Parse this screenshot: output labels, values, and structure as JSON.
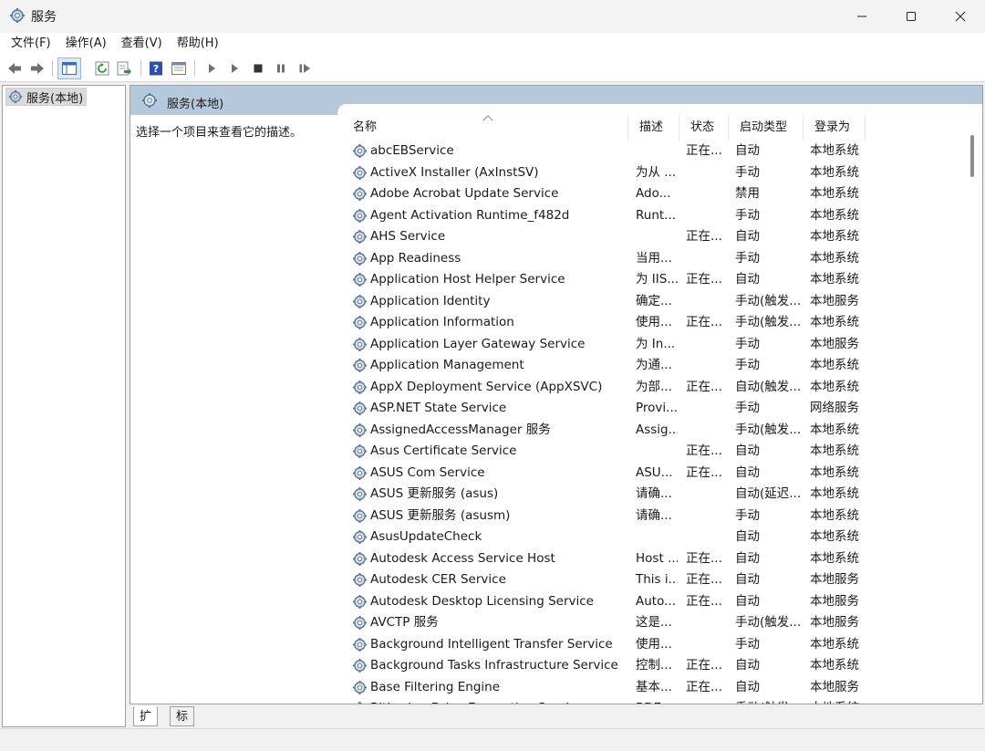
{
  "window": {
    "title": "服务",
    "minimize_icon": "minimize-icon",
    "maximize_icon": "maximize-icon",
    "close_icon": "close-icon"
  },
  "menu": [
    "文件(F)",
    "操作(A)",
    "查看(V)",
    "帮助(H)"
  ],
  "toolbar": [
    "back-arrow-icon",
    "forward-arrow-icon",
    "console-tree-icon",
    "refresh-icon",
    "export-list-icon",
    "help-icon",
    "properties-icon",
    "start-service-icon",
    "start-service-alt-icon",
    "stop-service-icon",
    "pause-service-icon",
    "restart-service-icon"
  ],
  "tree": {
    "root": "服务(本地)"
  },
  "panel": {
    "title": "服务(本地)",
    "description": "选择一个项目来查看它的描述。"
  },
  "columns": {
    "name": "名称",
    "desc": "描述",
    "status": "状态",
    "startup": "启动类型",
    "logon": "登录为"
  },
  "rows": [
    {
      "name": "abcEBService",
      "desc": "",
      "status": "正在...",
      "startup": "自动",
      "logon": "本地系统"
    },
    {
      "name": "ActiveX Installer (AxInstSV)",
      "desc": "为从 ...",
      "status": "",
      "startup": "手动",
      "logon": "本地系统"
    },
    {
      "name": "Adobe Acrobat Update Service",
      "desc": "Ado...",
      "status": "",
      "startup": "禁用",
      "logon": "本地系统"
    },
    {
      "name": "Agent Activation Runtime_f482d",
      "desc": "Runt...",
      "status": "",
      "startup": "手动",
      "logon": "本地系统"
    },
    {
      "name": "AHS Service",
      "desc": "",
      "status": "正在...",
      "startup": "自动",
      "logon": "本地系统"
    },
    {
      "name": "App Readiness",
      "desc": "当用...",
      "status": "",
      "startup": "手动",
      "logon": "本地系统"
    },
    {
      "name": "Application Host Helper Service",
      "desc": "为 IIS...",
      "status": "正在...",
      "startup": "自动",
      "logon": "本地系统"
    },
    {
      "name": "Application Identity",
      "desc": "确定...",
      "status": "",
      "startup": "手动(触发...",
      "logon": "本地服务"
    },
    {
      "name": "Application Information",
      "desc": "使用...",
      "status": "正在...",
      "startup": "手动(触发...",
      "logon": "本地系统"
    },
    {
      "name": "Application Layer Gateway Service",
      "desc": "为 In...",
      "status": "",
      "startup": "手动",
      "logon": "本地服务"
    },
    {
      "name": "Application Management",
      "desc": "为通...",
      "status": "",
      "startup": "手动",
      "logon": "本地系统"
    },
    {
      "name": "AppX Deployment Service (AppXSVC)",
      "desc": "为部...",
      "status": "正在...",
      "startup": "自动(触发...",
      "logon": "本地系统"
    },
    {
      "name": "ASP.NET State Service",
      "desc": "Provi...",
      "status": "",
      "startup": "手动",
      "logon": "网络服务"
    },
    {
      "name": "AssignedAccessManager 服务",
      "desc": "Assig...",
      "status": "",
      "startup": "手动(触发...",
      "logon": "本地系统"
    },
    {
      "name": "Asus Certificate Service",
      "desc": "",
      "status": "正在...",
      "startup": "自动",
      "logon": "本地系统"
    },
    {
      "name": "ASUS Com Service",
      "desc": "ASU...",
      "status": "正在...",
      "startup": "自动",
      "logon": "本地系统"
    },
    {
      "name": "ASUS 更新服务 (asus)",
      "desc": "请确...",
      "status": "",
      "startup": "自动(延迟...",
      "logon": "本地系统"
    },
    {
      "name": "ASUS 更新服务 (asusm)",
      "desc": "请确...",
      "status": "",
      "startup": "手动",
      "logon": "本地系统"
    },
    {
      "name": "AsusUpdateCheck",
      "desc": "",
      "status": "",
      "startup": "自动",
      "logon": "本地系统"
    },
    {
      "name": "Autodesk Access Service Host",
      "desc": "Host ...",
      "status": "正在...",
      "startup": "自动",
      "logon": "本地系统"
    },
    {
      "name": "Autodesk CER Service",
      "desc": "This i...",
      "status": "正在...",
      "startup": "自动",
      "logon": "本地服务"
    },
    {
      "name": "Autodesk Desktop Licensing Service",
      "desc": "Auto...",
      "status": "正在...",
      "startup": "自动",
      "logon": "本地服务"
    },
    {
      "name": "AVCTP 服务",
      "desc": "这是...",
      "status": "",
      "startup": "手动(触发...",
      "logon": "本地服务"
    },
    {
      "name": "Background Intelligent Transfer Service",
      "desc": "使用...",
      "status": "",
      "startup": "手动",
      "logon": "本地系统"
    },
    {
      "name": "Background Tasks Infrastructure Service",
      "desc": "控制...",
      "status": "正在...",
      "startup": "自动",
      "logon": "本地系统"
    },
    {
      "name": "Base Filtering Engine",
      "desc": "基本...",
      "status": "正在...",
      "startup": "自动",
      "logon": "本地服务"
    },
    {
      "name": "BitLocker Drive Encryption Service",
      "desc": "BDE...",
      "status": "",
      "startup": "手动(触发...",
      "logon": "本地系统"
    }
  ],
  "tabs": [
    "扩展",
    "标准"
  ],
  "colors": {
    "banner": "#b6c8dc",
    "tree_selected": "#dadada"
  }
}
